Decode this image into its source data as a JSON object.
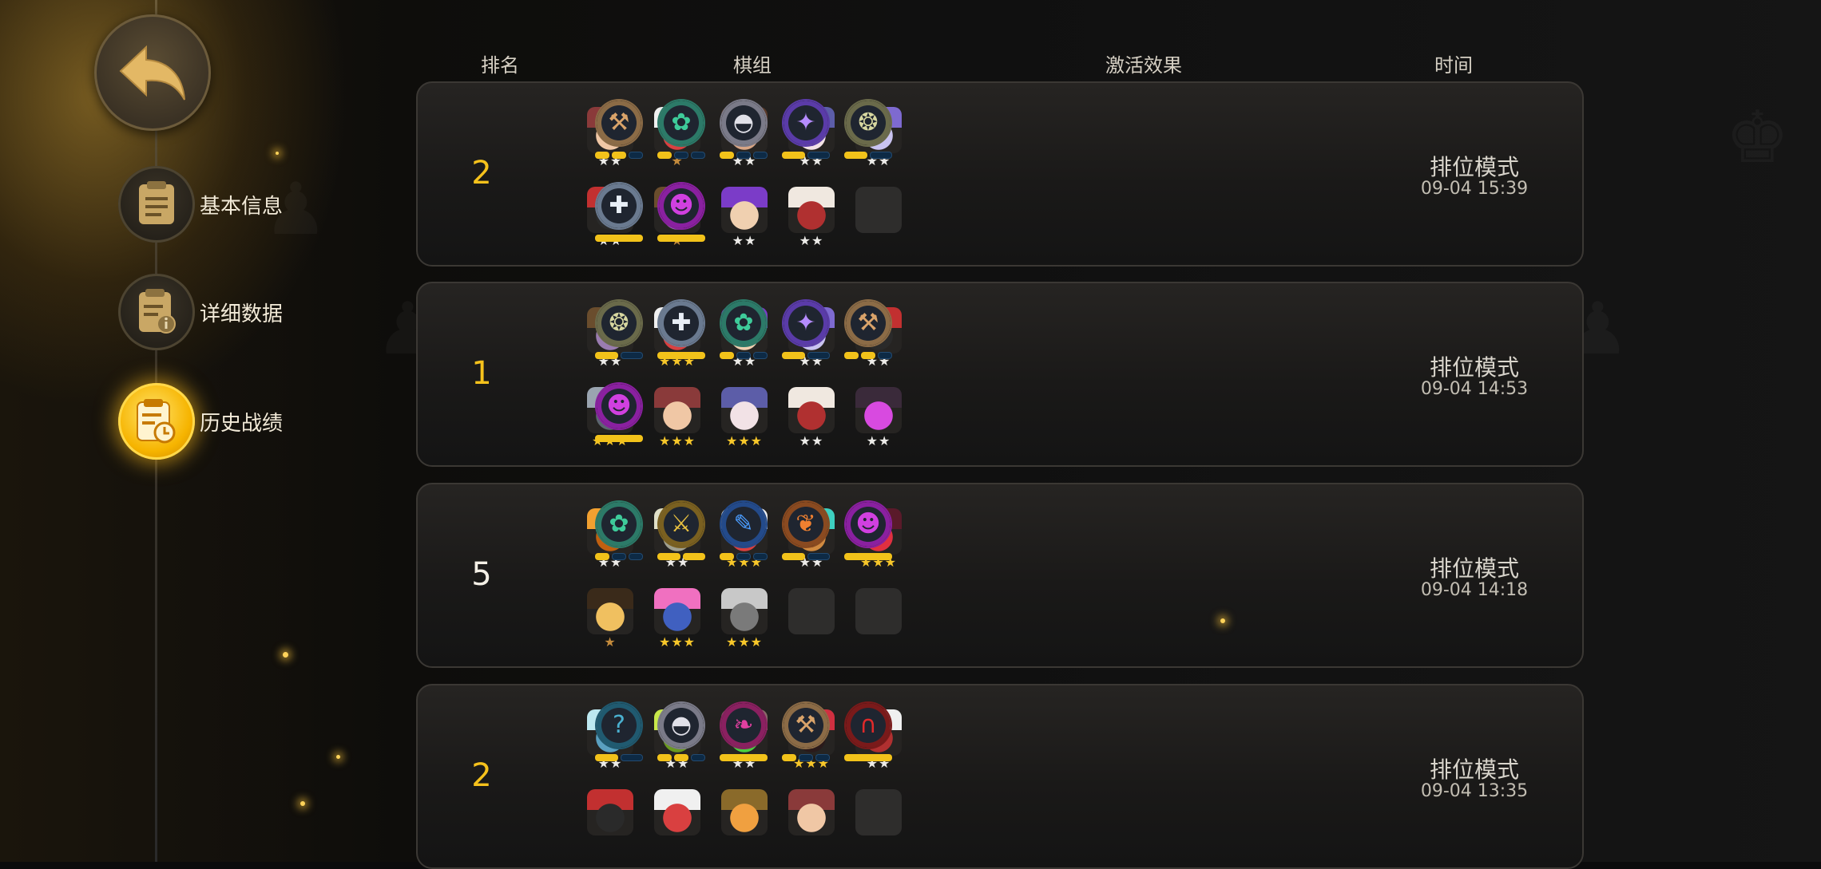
{
  "nav": {
    "items": [
      {
        "label": "基本信息",
        "icon": "document-icon",
        "active": false
      },
      {
        "label": "详细数据",
        "icon": "info-document-icon",
        "active": false
      },
      {
        "label": "历史战绩",
        "icon": "history-clock-icon",
        "active": true
      }
    ]
  },
  "headers": {
    "rank": "排名",
    "lineup": "棋组",
    "traits": "激活效果",
    "time": "时间"
  },
  "rows": [
    {
      "rank": "2",
      "mode": "排位模式",
      "time": "09-04 15:39",
      "units": [
        {
          "name": "bearded-warrior",
          "stars": "★★",
          "star_color": "white",
          "c1": "#8a3a3a",
          "c2": "#f0c7a5"
        },
        {
          "name": "white-sheep",
          "stars": "★",
          "star_color": "bronze",
          "c1": "#f0f0f0",
          "c2": "#d94040"
        },
        {
          "name": "goggle-brute",
          "stars": "★★",
          "star_color": "white",
          "c1": "#5a3a2a",
          "c2": "#d9a584"
        },
        {
          "name": "pale-wizard",
          "stars": "★★",
          "star_color": "white",
          "c1": "#5c5da8",
          "c2": "#f2e2e6"
        },
        {
          "name": "purple-knight",
          "stars": "★★",
          "star_color": "white",
          "c1": "#7e6ad0",
          "c2": "#c9c3f0"
        },
        {
          "name": "red-hat-rogue",
          "stars": "★★",
          "star_color": "white",
          "c1": "#c23030",
          "c2": "#2a2a2a"
        },
        {
          "name": "hooded-shaman",
          "stars": "★",
          "star_color": "bronze",
          "c1": "#6a4d2d",
          "c2": "#9a7cb0"
        },
        {
          "name": "purple-hair-gunner",
          "stars": "★★",
          "star_color": "white",
          "c1": "#7b3cc8",
          "c2": "#f0d0b0"
        },
        {
          "name": "skull-mage",
          "stars": "★★",
          "star_color": "white",
          "c1": "#f0e8e0",
          "c2": "#b03030"
        },
        {
          "name": "empty",
          "stars": "",
          "star_color": "white",
          "c1": "",
          "c2": ""
        }
      ],
      "traits": [
        {
          "name": "axe-trait-icon",
          "glyph": "⚒",
          "color": "#d9a36a",
          "ring": "#8b6b46",
          "bars": [
            1,
            1,
            0
          ]
        },
        {
          "name": "paw-trait-icon",
          "glyph": "✿",
          "color": "#3ecb9a",
          "ring": "#2c7a68",
          "bars": [
            1,
            0,
            0
          ]
        },
        {
          "name": "helmet-trait-icon",
          "glyph": "◓",
          "color": "#e0e0e8",
          "ring": "#7a7a88",
          "bars": [
            1,
            0,
            0
          ]
        },
        {
          "name": "fishbone-trait-icon",
          "glyph": "✦",
          "color": "#b58cff",
          "ring": "#5a3ba8",
          "bars": [
            1,
            0
          ]
        },
        {
          "name": "beetle-trait-icon",
          "glyph": "❂",
          "color": "#d7d7a0",
          "ring": "#6a6a4a",
          "bars": [
            1,
            0
          ]
        },
        {
          "name": "cross-trait-icon",
          "glyph": "✚",
          "color": "#e8eef6",
          "ring": "#6a7a90",
          "bars": [
            1
          ]
        },
        {
          "name": "demon-trait-icon",
          "glyph": "☻",
          "color": "#d040e0",
          "ring": "#8a20a0",
          "bars": [
            1
          ]
        }
      ]
    },
    {
      "rank": "1",
      "mode": "排位模式",
      "time": "09-04 14:53",
      "units": [
        {
          "name": "hooded-shaman",
          "stars": "★★",
          "star_color": "white",
          "c1": "#6a4d2d",
          "c2": "#9a7cb0"
        },
        {
          "name": "white-sheep",
          "stars": "★★★",
          "star_color": "gold",
          "c1": "#f0f0f0",
          "c2": "#d94040"
        },
        {
          "name": "purple-hair-gunner",
          "stars": "★★",
          "star_color": "white",
          "c1": "#7b3cc8",
          "c2": "#f0d0b0"
        },
        {
          "name": "purple-knight",
          "stars": "★★",
          "star_color": "white",
          "c1": "#7e6ad0",
          "c2": "#c9c3f0"
        },
        {
          "name": "red-hat-rogue",
          "stars": "★★",
          "star_color": "white",
          "c1": "#c23030",
          "c2": "#2a2a2a"
        },
        {
          "name": "steel-golem",
          "stars": "★★★",
          "star_color": "gold",
          "c1": "#9aa4b0",
          "c2": "#5c6670"
        },
        {
          "name": "bearded-warrior",
          "stars": "★★★",
          "star_color": "gold",
          "c1": "#8a3a3a",
          "c2": "#f0c7a5"
        },
        {
          "name": "pale-wizard",
          "stars": "★★★",
          "star_color": "gold",
          "c1": "#5c5da8",
          "c2": "#f2e2e6"
        },
        {
          "name": "skull-mage",
          "stars": "★★",
          "star_color": "white",
          "c1": "#f0e8e0",
          "c2": "#b03030"
        },
        {
          "name": "shadow-assassin",
          "stars": "★★",
          "star_color": "white",
          "c1": "#3a2a3a",
          "c2": "#d84ae0"
        }
      ],
      "traits": [
        {
          "name": "beetle-trait-icon",
          "glyph": "❂",
          "color": "#d7d7a0",
          "ring": "#6a6a4a",
          "bars": [
            1,
            0
          ]
        },
        {
          "name": "cross-trait-icon",
          "glyph": "✚",
          "color": "#e8eef6",
          "ring": "#6a7a90",
          "bars": [
            1
          ]
        },
        {
          "name": "paw-trait-icon",
          "glyph": "✿",
          "color": "#3ecb9a",
          "ring": "#2c7a68",
          "bars": [
            1,
            0,
            0
          ]
        },
        {
          "name": "fishbone-trait-icon",
          "glyph": "✦",
          "color": "#b58cff",
          "ring": "#5a3ba8",
          "bars": [
            1,
            0
          ]
        },
        {
          "name": "axe-trait-icon",
          "glyph": "⚒",
          "color": "#d9a36a",
          "ring": "#8b6b46",
          "bars": [
            1,
            1,
            0
          ]
        },
        {
          "name": "demon-trait-icon",
          "glyph": "☻",
          "color": "#d040e0",
          "ring": "#8a20a0",
          "bars": [
            1
          ]
        }
      ]
    },
    {
      "rank": "5",
      "mode": "排位模式",
      "time": "09-04 14:18",
      "units": [
        {
          "name": "orange-claw-beast",
          "stars": "★★",
          "star_color": "white",
          "c1": "#f2a030",
          "c2": "#c06010"
        },
        {
          "name": "straw-hat-elder",
          "stars": "★★",
          "star_color": "white",
          "c1": "#e0e0c8",
          "c2": "#a0a090"
        },
        {
          "name": "white-sheep",
          "stars": "★★★",
          "star_color": "gold",
          "c1": "#f0f0f0",
          "c2": "#d94040"
        },
        {
          "name": "teal-robot",
          "stars": "★★",
          "star_color": "white",
          "c1": "#3ed0c0",
          "c2": "#d08a40"
        },
        {
          "name": "horned-demon",
          "stars": "★★★",
          "star_color": "gold",
          "c1": "#5a1a2a",
          "c2": "#e03040"
        },
        {
          "name": "golden-monk",
          "stars": "★",
          "star_color": "bronze",
          "c1": "#3a2a1a",
          "c2": "#f0c060"
        },
        {
          "name": "pink-hair-girl",
          "stars": "★★★",
          "star_color": "gold",
          "c1": "#f070c0",
          "c2": "#4060c0"
        },
        {
          "name": "elephant-knight",
          "stars": "★★★",
          "star_color": "gold",
          "c1": "#c8c8c8",
          "c2": "#7a7a7a"
        },
        {
          "name": "empty",
          "stars": "",
          "star_color": "white",
          "c1": "",
          "c2": ""
        },
        {
          "name": "empty",
          "stars": "",
          "star_color": "white",
          "c1": "",
          "c2": ""
        }
      ],
      "traits": [
        {
          "name": "paw-trait-icon",
          "glyph": "✿",
          "color": "#3ecb9a",
          "ring": "#2c7a68",
          "bars": [
            1,
            0,
            0
          ]
        },
        {
          "name": "twin-daggers-trait-icon",
          "glyph": "⚔",
          "color": "#e8c040",
          "ring": "#7a6020",
          "bars": [
            1,
            1
          ]
        },
        {
          "name": "feather-trait-icon",
          "glyph": "✎",
          "color": "#4a9cff",
          "ring": "#234a8a",
          "bars": [
            1,
            0,
            0
          ]
        },
        {
          "name": "leaf-trait-icon",
          "glyph": "❦",
          "color": "#f08030",
          "ring": "#8a4a20",
          "bars": [
            1,
            0
          ]
        },
        {
          "name": "demon-trait-icon",
          "glyph": "☻",
          "color": "#d040e0",
          "ring": "#8a20a0",
          "bars": [
            1
          ]
        }
      ]
    },
    {
      "rank": "2",
      "mode": "排位模式",
      "time": "09-04 13:35",
      "units": [
        {
          "name": "ice-bear",
          "stars": "★★",
          "star_color": "white",
          "c1": "#bde8f0",
          "c2": "#5aa0c0"
        },
        {
          "name": "green-frog",
          "stars": "★★",
          "star_color": "white",
          "c1": "#c8e84a",
          "c2": "#6a9a20"
        },
        {
          "name": "mohawk-ogre",
          "stars": "★★",
          "star_color": "white",
          "c1": "#8a6a6a",
          "c2": "#4ad040"
        },
        {
          "name": "red-oni",
          "stars": "★★★",
          "star_color": "gold",
          "c1": "#d03040",
          "c2": "#2a1a1a"
        },
        {
          "name": "white-yeti",
          "stars": "★★",
          "star_color": "white",
          "c1": "#f0f0f0",
          "c2": "#b03030"
        },
        {
          "name": "red-hat-rogue",
          "stars": "",
          "star_color": "white",
          "c1": "#c23030",
          "c2": "#2a2a2a"
        },
        {
          "name": "white-sheep",
          "stars": "",
          "star_color": "white",
          "c1": "#f0f0f0",
          "c2": "#d94040"
        },
        {
          "name": "owl-druid",
          "stars": "",
          "star_color": "white",
          "c1": "#8a6a2a",
          "c2": "#f0a040"
        },
        {
          "name": "bearded-warrior",
          "stars": "",
          "star_color": "white",
          "c1": "#8a3a3a",
          "c2": "#f0c7a5"
        },
        {
          "name": "empty",
          "stars": "",
          "star_color": "white",
          "c1": "",
          "c2": ""
        }
      ],
      "traits": [
        {
          "name": "question-trait-icon",
          "glyph": "?",
          "color": "#4ab0d0",
          "ring": "#205a70",
          "bars": [
            1,
            0
          ]
        },
        {
          "name": "helmet-trait-icon",
          "glyph": "◓",
          "color": "#e0e0e8",
          "ring": "#7a7a88",
          "bars": [
            1,
            1,
            0
          ]
        },
        {
          "name": "dragon-trait-icon",
          "glyph": "❧",
          "color": "#e040a0",
          "ring": "#8a2060",
          "bars": [
            1
          ]
        },
        {
          "name": "axe-trait-icon",
          "glyph": "⚒",
          "color": "#d9a36a",
          "ring": "#8b6b46",
          "bars": [
            1,
            0,
            0
          ]
        },
        {
          "name": "arch-trait-icon",
          "glyph": "∩",
          "color": "#e02a2a",
          "ring": "#7a1a1a",
          "bars": [
            1
          ]
        }
      ]
    }
  ]
}
